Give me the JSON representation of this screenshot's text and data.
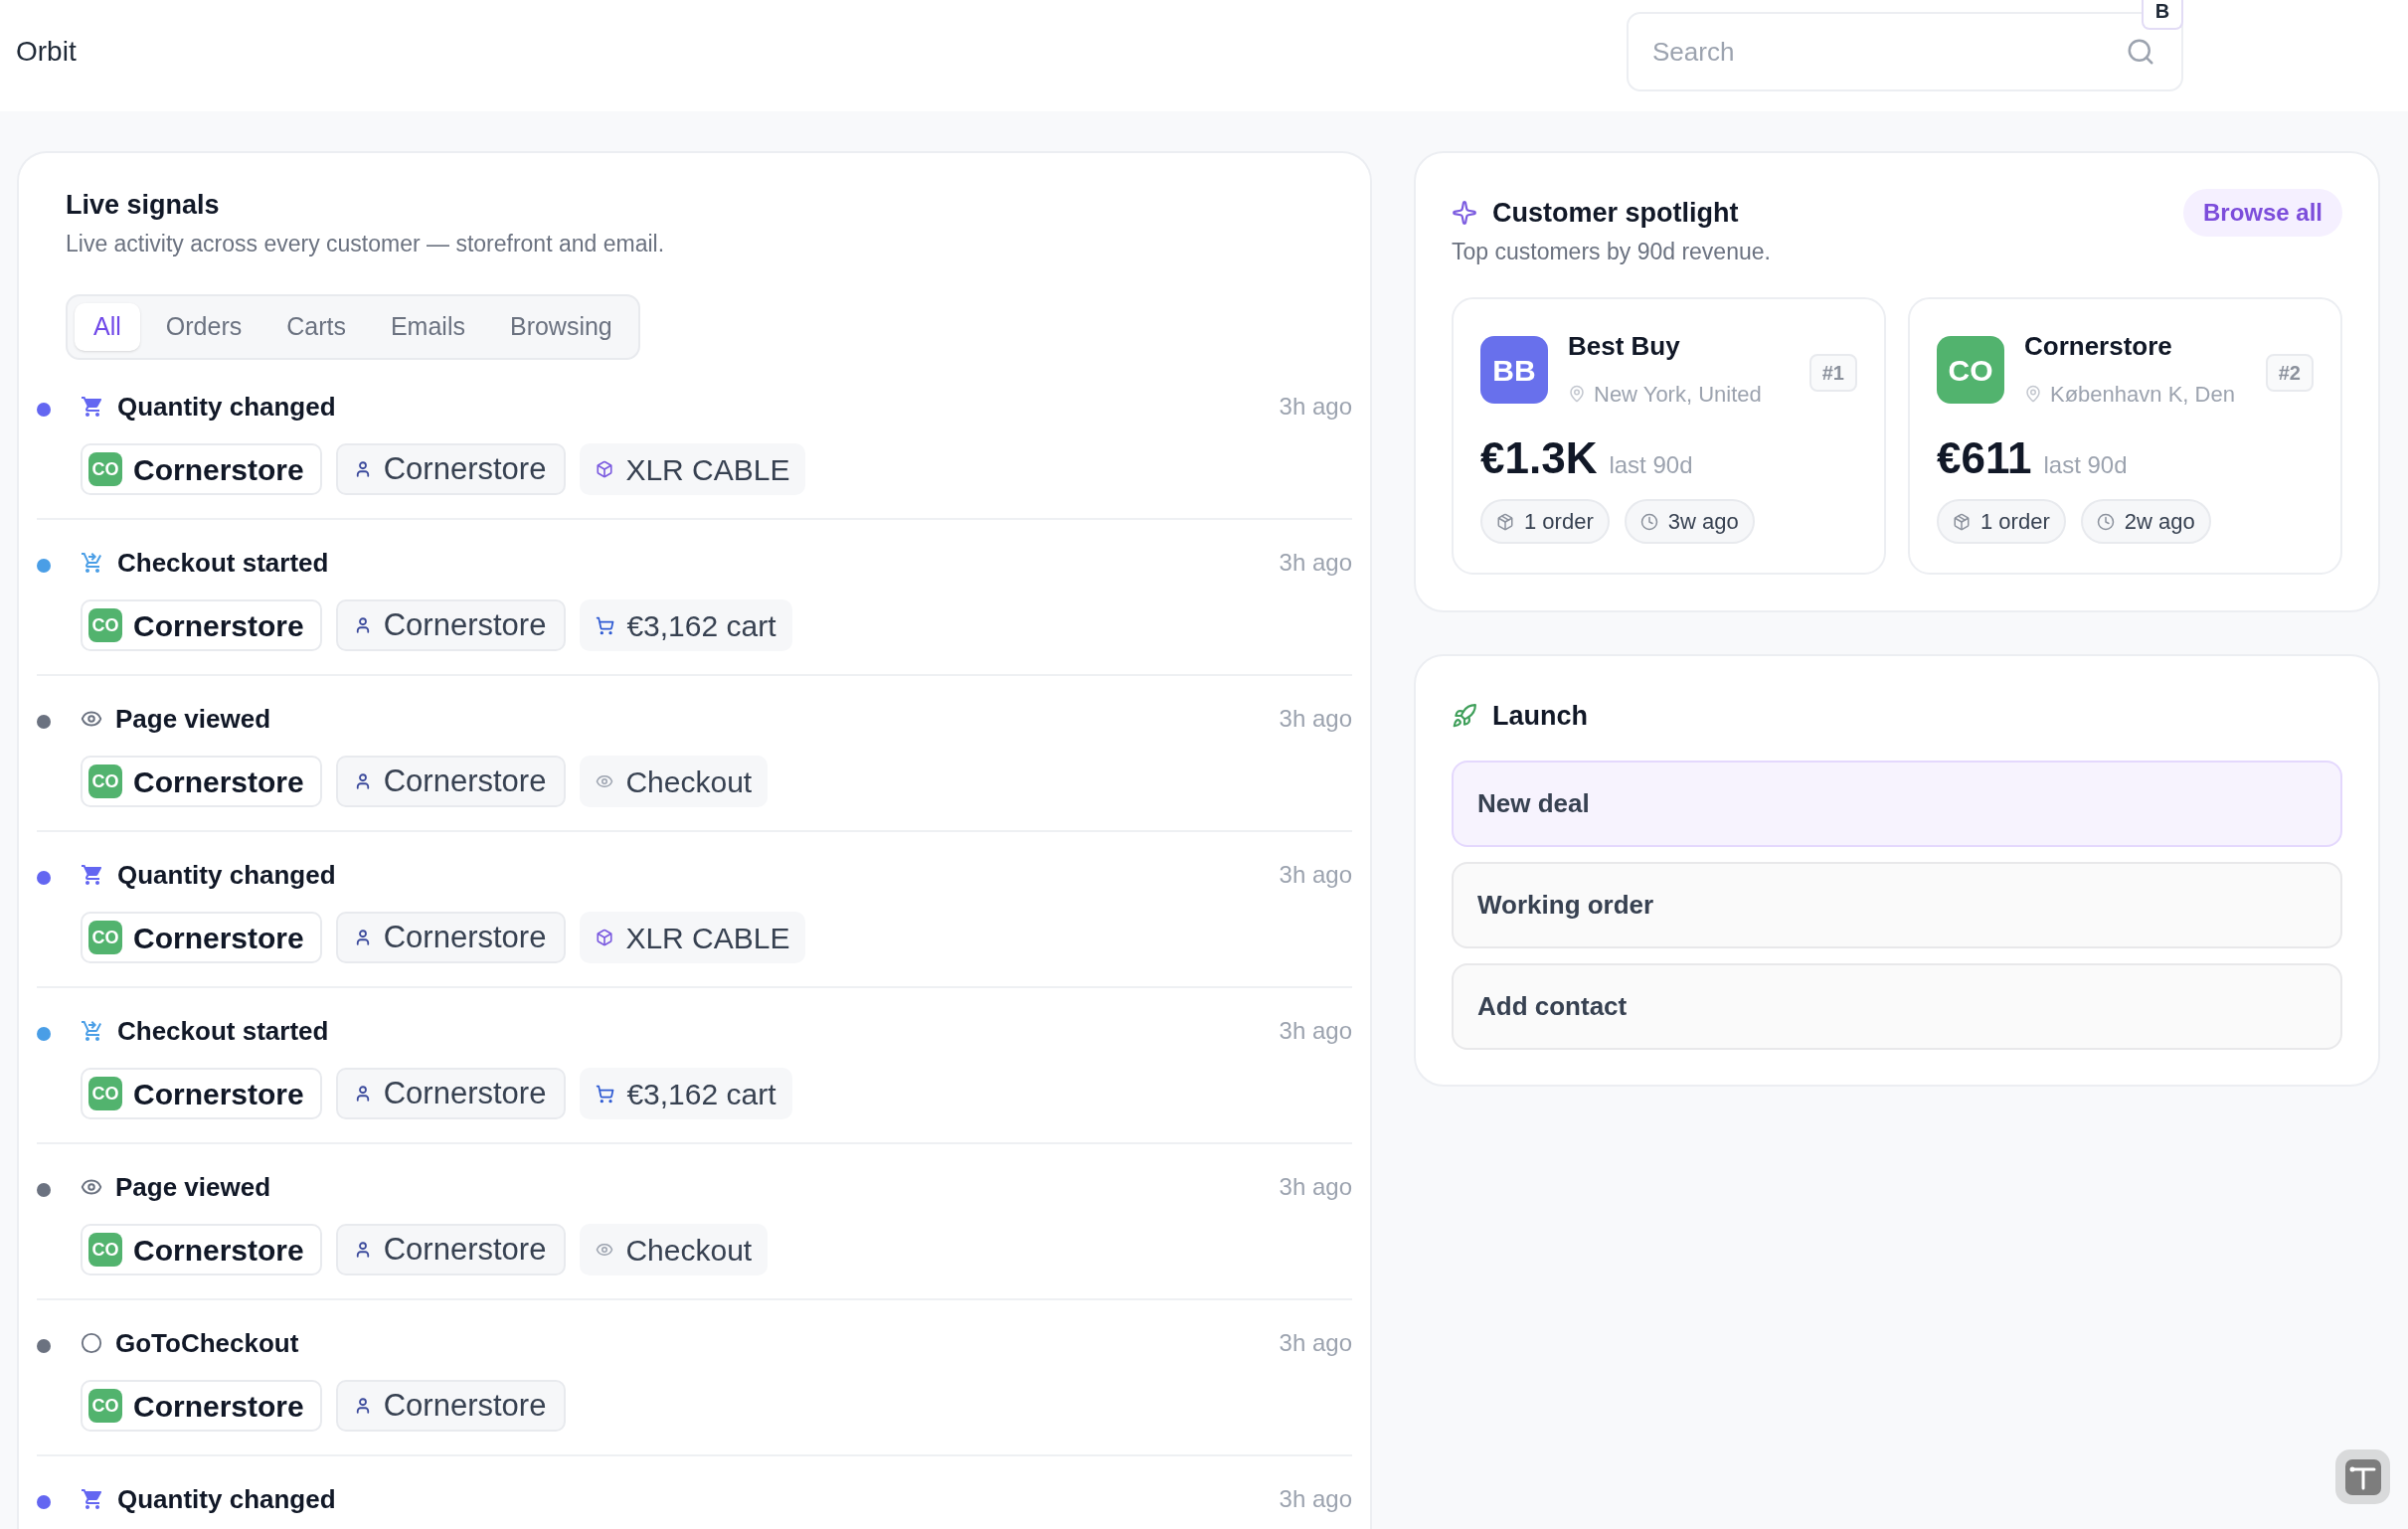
{
  "app": {
    "title": "Orbit"
  },
  "search": {
    "placeholder": "Search",
    "badge": "B"
  },
  "live_signals": {
    "title": "Live signals",
    "subtitle": "Live activity across every customer — storefront and email.",
    "tabs": [
      {
        "label": "All",
        "selected": true
      },
      {
        "label": "Orders",
        "selected": false
      },
      {
        "label": "Carts",
        "selected": false
      },
      {
        "label": "Emails",
        "selected": false
      },
      {
        "label": "Browsing",
        "selected": false
      }
    ],
    "events": [
      {
        "kind": "cart",
        "title": "Quantity changed",
        "time": "3h ago",
        "color": "#6366f1",
        "company": {
          "initials": "CO",
          "name": "Cornerstore",
          "color": "#52b36e"
        },
        "contact": "Cornerstore",
        "detail": {
          "kind": "product",
          "text": "XLR CABLE"
        }
      },
      {
        "kind": "checkout",
        "title": "Checkout started",
        "time": "3h ago",
        "color": "#4a9ee6",
        "company": {
          "initials": "CO",
          "name": "Cornerstore",
          "color": "#52b36e"
        },
        "contact": "Cornerstore",
        "detail": {
          "kind": "cart",
          "text": "€3,162 cart"
        }
      },
      {
        "kind": "view",
        "title": "Page viewed",
        "time": "3h ago",
        "color": "#6b7280",
        "company": {
          "initials": "CO",
          "name": "Cornerstore",
          "color": "#52b36e"
        },
        "contact": "Cornerstore",
        "detail": {
          "kind": "page",
          "text": "Checkout"
        }
      },
      {
        "kind": "cart",
        "title": "Quantity changed",
        "time": "3h ago",
        "color": "#6366f1",
        "company": {
          "initials": "CO",
          "name": "Cornerstore",
          "color": "#52b36e"
        },
        "contact": "Cornerstore",
        "detail": {
          "kind": "product",
          "text": "XLR CABLE"
        }
      },
      {
        "kind": "checkout",
        "title": "Checkout started",
        "time": "3h ago",
        "color": "#4a9ee6",
        "company": {
          "initials": "CO",
          "name": "Cornerstore",
          "color": "#52b36e"
        },
        "contact": "Cornerstore",
        "detail": {
          "kind": "cart",
          "text": "€3,162 cart"
        }
      },
      {
        "kind": "view",
        "title": "Page viewed",
        "time": "3h ago",
        "color": "#6b7280",
        "company": {
          "initials": "CO",
          "name": "Cornerstore",
          "color": "#52b36e"
        },
        "contact": "Cornerstore",
        "detail": {
          "kind": "page",
          "text": "Checkout"
        }
      },
      {
        "kind": "generic",
        "title": "GoToCheckout",
        "time": "3h ago",
        "color": "#6b7280",
        "company": {
          "initials": "CO",
          "name": "Cornerstore",
          "color": "#52b36e"
        },
        "contact": "Cornerstore"
      },
      {
        "kind": "cart",
        "title": "Quantity changed",
        "time": "3h ago",
        "color": "#6366f1"
      }
    ]
  },
  "spotlight": {
    "title": "Customer spotlight",
    "subtitle": "Top customers by 90d revenue.",
    "action": "Browse all",
    "customers": [
      {
        "initials": "BB",
        "color": "#6870ec",
        "name": "Best Buy",
        "location": "New York, United",
        "rank": "#1",
        "revenue": "€1.3K",
        "period": "last 90d",
        "orders": "1 order",
        "last_seen": "3w ago"
      },
      {
        "initials": "CO",
        "color": "#52b36e",
        "name": "Cornerstore",
        "location": "København K, Den",
        "rank": "#2",
        "revenue": "€611",
        "period": "last 90d",
        "orders": "1 order",
        "last_seen": "2w ago"
      }
    ]
  },
  "launch": {
    "title": "Launch",
    "actions": [
      {
        "label": "New deal",
        "selected": true
      },
      {
        "label": "Working order",
        "selected": false
      },
      {
        "label": "Add contact",
        "selected": false
      }
    ]
  }
}
